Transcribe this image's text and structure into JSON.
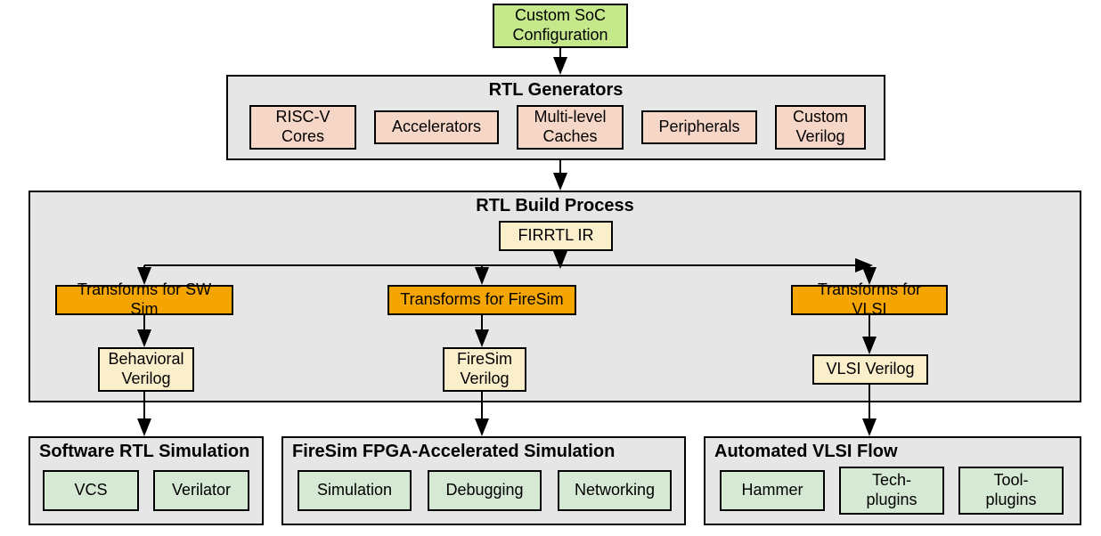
{
  "top": {
    "soc_config": "Custom SoC\nConfiguration"
  },
  "rtl_generators": {
    "title": "RTL Generators",
    "items": [
      "RISC-V\nCores",
      "Accelerators",
      "Multi-level\nCaches",
      "Peripherals",
      "Custom\nVerilog"
    ]
  },
  "rtl_build": {
    "title": "RTL Build Process",
    "firrtl": "FIRRTL IR",
    "branches": [
      {
        "transform": "Transforms for SW Sim",
        "verilog": "Behavioral\nVerilog"
      },
      {
        "transform": "Transforms for FireSim",
        "verilog": "FireSim\nVerilog"
      },
      {
        "transform": "Transforms for VLSI",
        "verilog": "VLSI Verilog"
      }
    ]
  },
  "outputs": [
    {
      "title": "Software RTL Simulation",
      "items": [
        "VCS",
        "Verilator"
      ]
    },
    {
      "title": "FireSim FPGA-Accelerated Simulation",
      "items": [
        "Simulation",
        "Debugging",
        "Networking"
      ]
    },
    {
      "title": "Automated VLSI Flow",
      "items": [
        "Hammer",
        "Tech-\nplugins",
        "Tool-\nplugins"
      ]
    }
  ]
}
